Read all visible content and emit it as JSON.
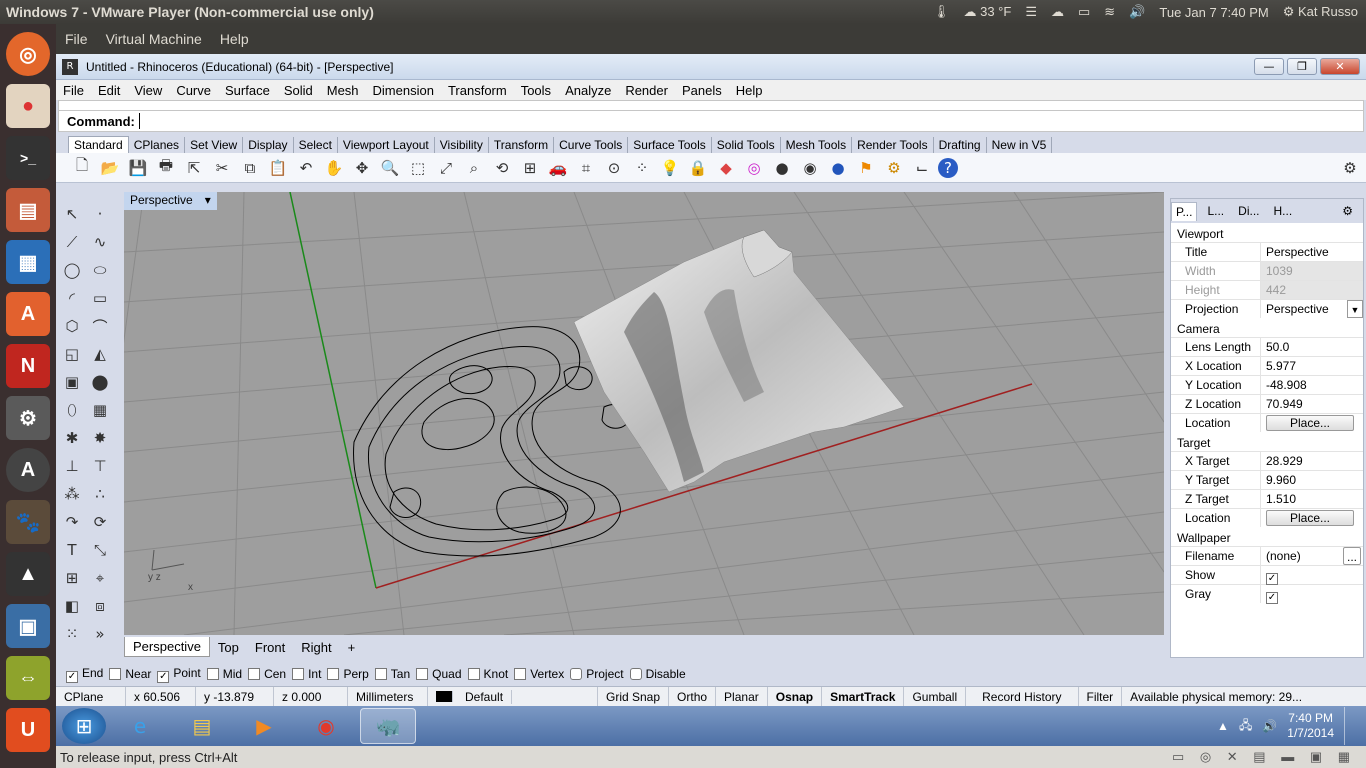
{
  "ubuntu_bar": {
    "title": "Windows 7 - VMware Player (Non-commercial use only)",
    "temperature": "33 °F",
    "datetime": "Tue Jan  7   7:40 PM",
    "user": "Kat Russo"
  },
  "vm_menu": [
    "File",
    "Virtual Machine",
    "Help"
  ],
  "window": {
    "title": "Untitled - Rhinoceros (Educational) (64-bit) - [Perspective]"
  },
  "menubar": [
    "File",
    "Edit",
    "View",
    "Curve",
    "Surface",
    "Solid",
    "Mesh",
    "Dimension",
    "Transform",
    "Tools",
    "Analyze",
    "Render",
    "Panels",
    "Help"
  ],
  "command": {
    "label": "Command:"
  },
  "toolbar_tabs": [
    "Standard",
    "CPlanes",
    "Set View",
    "Display",
    "Select",
    "Viewport Layout",
    "Visibility",
    "Transform",
    "Curve Tools",
    "Surface Tools",
    "Solid Tools",
    "Mesh Tools",
    "Render Tools",
    "Drafting",
    "New in V5"
  ],
  "viewport": {
    "label": "Perspective",
    "axis_label": "y  z",
    "axis_x": "x"
  },
  "viewport_tabs": [
    "Perspective",
    "Top",
    "Front",
    "Right",
    "+"
  ],
  "osnaps": [
    {
      "label": "End",
      "checked": true
    },
    {
      "label": "Near",
      "checked": false
    },
    {
      "label": "Point",
      "checked": true
    },
    {
      "label": "Mid",
      "checked": false
    },
    {
      "label": "Cen",
      "checked": false
    },
    {
      "label": "Int",
      "checked": false
    },
    {
      "label": "Perp",
      "checked": false
    },
    {
      "label": "Tan",
      "checked": false
    },
    {
      "label": "Quad",
      "checked": false
    },
    {
      "label": "Knot",
      "checked": false
    },
    {
      "label": "Vertex",
      "checked": false
    },
    {
      "label": "Project",
      "checked": false
    },
    {
      "label": "Disable",
      "checked": false
    }
  ],
  "status": {
    "cplane": "CPlane",
    "x": "x 60.506",
    "y": "y -13.879",
    "z": "z 0.000",
    "units": "Millimeters",
    "layer": "Default",
    "grid_snap": "Grid Snap",
    "ortho": "Ortho",
    "planar": "Planar",
    "osnap": "Osnap",
    "smarttrack": "SmartTrack",
    "gumball": "Gumball",
    "record_history": "Record History",
    "filter": "Filter",
    "memory": "Available physical memory: 29..."
  },
  "panel": {
    "tabs": [
      "P...",
      "L...",
      "Di...",
      "H..."
    ],
    "viewport_section": "Viewport",
    "title_k": "Title",
    "title_v": "Perspective",
    "width_k": "Width",
    "width_v": "1039",
    "height_k": "Height",
    "height_v": "442",
    "projection_k": "Projection",
    "projection_v": "Perspective",
    "camera_section": "Camera",
    "lens_k": "Lens Length",
    "lens_v": "50.0",
    "xloc_k": "X Location",
    "xloc_v": "5.977",
    "yloc_k": "Y Location",
    "yloc_v": "-48.908",
    "zloc_k": "Z Location",
    "zloc_v": "70.949",
    "loc_k": "Location",
    "place": "Place...",
    "target_section": "Target",
    "xt_k": "X Target",
    "xt_v": "28.929",
    "yt_k": "Y Target",
    "yt_v": "9.960",
    "zt_k": "Z Target",
    "zt_v": "1.510",
    "wallpaper_section": "Wallpaper",
    "file_k": "Filename",
    "file_v": "(none)",
    "file_btn": "...",
    "show_k": "Show",
    "gray_k": "Gray"
  },
  "taskbar": {
    "time": "7:40 PM",
    "date": "1/7/2014"
  },
  "vm_status": "To release input, press Ctrl+Alt"
}
